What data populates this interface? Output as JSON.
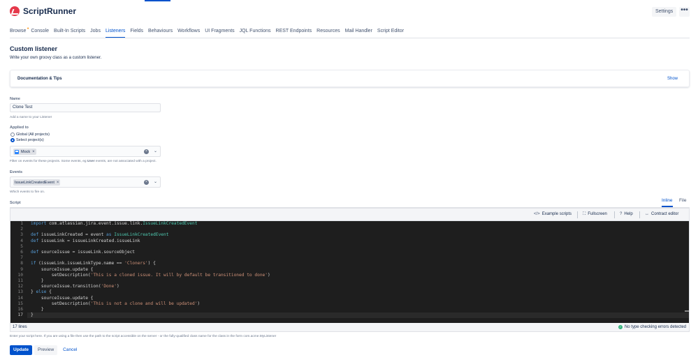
{
  "app": {
    "name": "ScriptRunner"
  },
  "header": {
    "settings_label": "Settings",
    "more_label": "•••"
  },
  "nav": {
    "items": [
      {
        "label": "Browse",
        "dot": "•"
      },
      {
        "label": "Console"
      },
      {
        "label": "Built-In Scripts"
      },
      {
        "label": "Jobs"
      },
      {
        "label": "Listeners"
      },
      {
        "label": "Fields"
      },
      {
        "label": "Behaviours"
      },
      {
        "label": "Workflows"
      },
      {
        "label": "UI Fragments"
      },
      {
        "label": "JQL Functions"
      },
      {
        "label": "REST Endpoints"
      },
      {
        "label": "Resources"
      },
      {
        "label": "Mail Handler"
      },
      {
        "label": "Script Editor"
      }
    ],
    "active": "Listeners"
  },
  "page": {
    "title": "Custom listener",
    "description": "Write your own groovy class as a custom listener."
  },
  "docs": {
    "title": "Documentation & Tips",
    "toggle": "Show"
  },
  "form": {
    "name": {
      "label": "Name",
      "value": "Clone Test",
      "hint": "Add a name to your Listener"
    },
    "applied_to": {
      "label": "Applied to",
      "options": [
        "Global (All projects)",
        "Select project(s)"
      ],
      "selected": "Select project(s)",
      "chip": "Mock",
      "hint_before": "Filter on events for these projects. Some events, eg ",
      "hint_bold": "User",
      "hint_after": " events, are not associated with a project."
    },
    "events": {
      "label": "Events",
      "chip": "IssueLinkCreatedEvent",
      "hint": "Which events to fire on."
    },
    "script": {
      "label": "Script",
      "tabs": [
        "Inline",
        "File"
      ],
      "active_tab": "Inline",
      "toolbar": {
        "example_scripts": "Example scripts",
        "fullscreen": "Fullscreen",
        "help": "Help",
        "contract_editor": "Contract editor"
      },
      "line_count": "17 lines",
      "status": "No type checking errors detected",
      "hint": "Enter your script here. If you are using a file then use the path to the script accessible on the server - or the fully-qualified class name for the class in the form com.acme.MyListener"
    }
  },
  "code_lines": [
    "import com.atlassian.jira.event.issue.link.IssueLinkCreatedEvent",
    "",
    "def issueLinkCreated = event as IssueLinkCreatedEvent",
    "def issueLink = issueLinkCreated.issueLink",
    "",
    "def sourceIssue = issueLink.sourceObject",
    "",
    "if (issueLink.issueLinkType.name == 'Cloners') {",
    "    sourceIssue.update {",
    "        setDescription('This is a cloned issue. It will by default be transitioned to done')",
    "    }",
    "    sourceIssue.transition('Done')",
    "} else {",
    "    sourceIssue.update {",
    "        setDescription('This is not a clone and will be updated')",
    "    }",
    "}"
  ],
  "line_numbers": [
    "1",
    "2",
    "3",
    "4",
    "5",
    "6",
    "7",
    "8",
    "9",
    "10",
    "11",
    "12",
    "13",
    "14",
    "15",
    "16",
    "17"
  ],
  "actions": {
    "update": "Update",
    "preview": "Preview",
    "cancel": "Cancel"
  },
  "colors": {
    "accent": "#0052cc",
    "brand": "#e5394b",
    "editor_bg": "#1e1e1e",
    "success": "#36b37e"
  },
  "icons": {
    "logo": "scriptrunner-logo-icon",
    "example_scripts": "code-icon",
    "fullscreen": "fullscreen-icon",
    "help": "help-icon",
    "contract_editor": "contract-icon",
    "status": "check-circle-icon"
  }
}
